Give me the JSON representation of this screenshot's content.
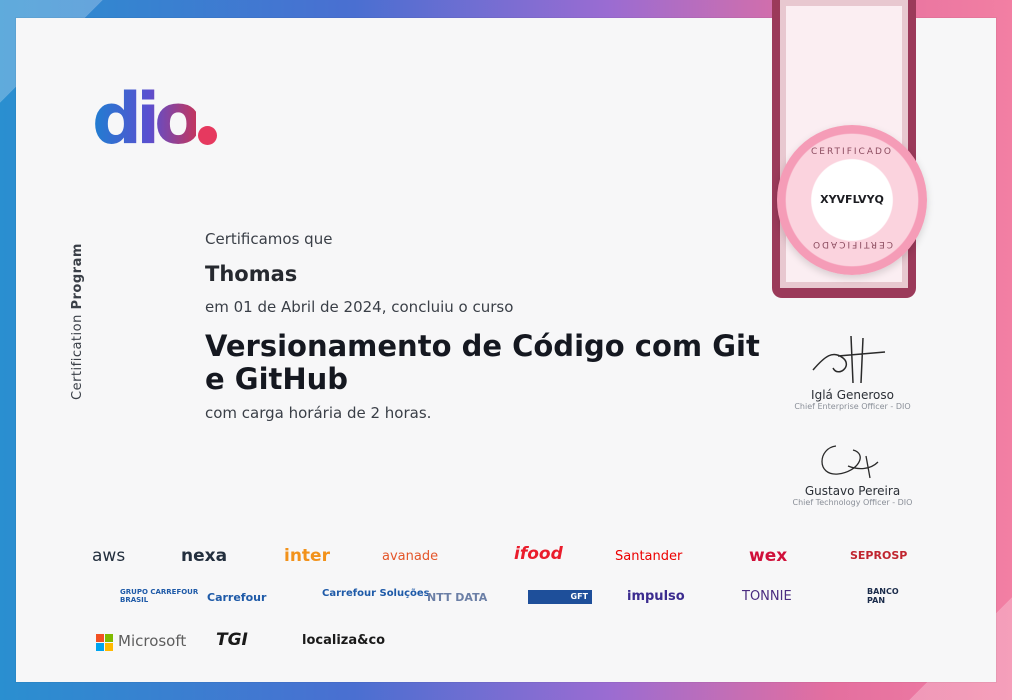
{
  "logo": {
    "text": "dio"
  },
  "side_caption": {
    "a": "Certification",
    "b": "Program"
  },
  "cert": {
    "intro": "Certificamos que",
    "name": "Thomas",
    "date_line": "em 01 de Abril de 2024, concluiu o curso",
    "course": "Versionamento de Código com Git e GitHub",
    "hours_line": "com carga horária de 2 horas."
  },
  "seal": {
    "top": "CERTIFICADO",
    "code": "XYVFLVYQ",
    "bottom": "CERTIFICADO"
  },
  "signatures": [
    {
      "name": "Iglá Generoso",
      "role": "Chief Enterprise Officer - DIO"
    },
    {
      "name": "Gustavo Pereira",
      "role": "Chief Technology Officer - DIO"
    }
  ],
  "partners": {
    "row1": [
      "aws",
      "nexa",
      "inter",
      "avanade",
      "ifood",
      "Santander",
      "wex",
      "SEPROSP"
    ],
    "row2": [
      "GRUPO CARREFOUR BRASIL",
      "Carrefour",
      "Carrefour Soluções",
      "NTT DATA",
      "GFT",
      "impulso",
      "TONNIE",
      "BANCO PAN"
    ],
    "row3": [
      "Microsoft",
      "TGI",
      "localiza&co"
    ]
  },
  "colors": {
    "accent_blue": "#1f7fd1",
    "accent_pink": "#e6395f",
    "ribbon": "#9b3a5a"
  }
}
